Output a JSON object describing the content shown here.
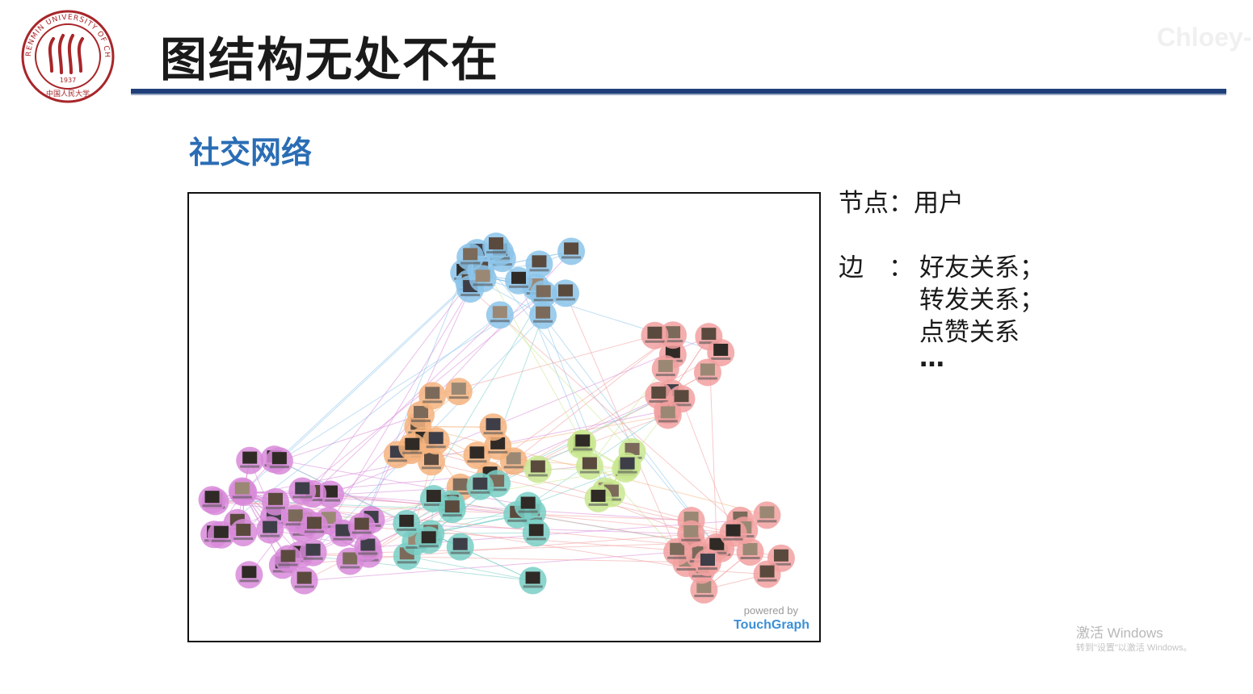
{
  "header": {
    "title": "图结构无处不在",
    "watermark": "Chloey-"
  },
  "logo": {
    "ring_text": "RENMIN UNIVERSITY OF CHINA",
    "year": "1937",
    "chinese_name": "中国人民大学",
    "color": "#a8262a"
  },
  "section": {
    "heading": "社交网络",
    "color": "#2a6db5"
  },
  "figure": {
    "powered_by": "powered by",
    "brand": "TouchGraph",
    "cluster_colors": {
      "blue": "#8cc4ea",
      "orange": "#f4b37e",
      "purple": "#d889d9",
      "teal": "#79cfc6",
      "green": "#c9e78f",
      "pink": "#f2a0a0"
    }
  },
  "description": {
    "nodes_label": "节点：",
    "nodes_value": "用户",
    "edges_label": "边　：",
    "edges_items": [
      "好友关系；",
      "转发关系；",
      "点赞关系"
    ],
    "ellipsis": "…"
  },
  "os_watermark": {
    "line1": "激活 Windows",
    "line2": "转到\"设置\"以激活 Windows。"
  }
}
